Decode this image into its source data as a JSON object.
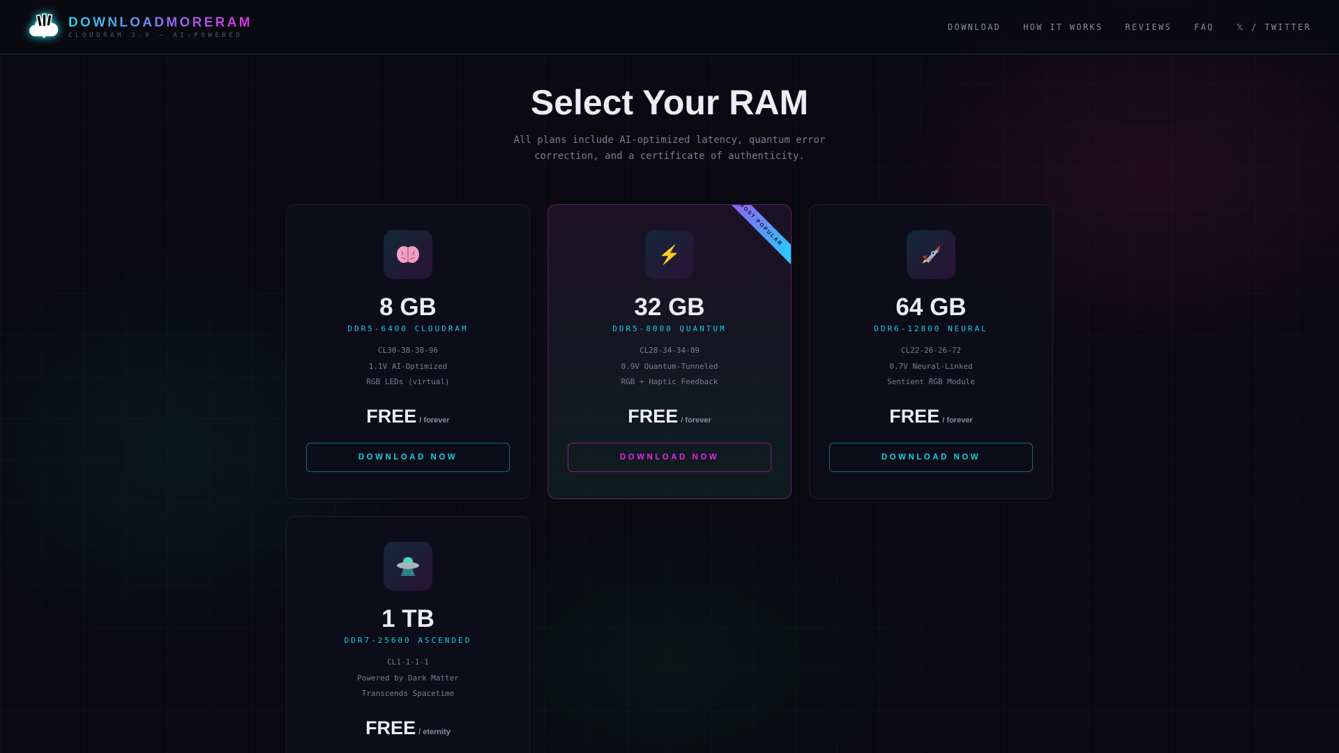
{
  "header": {
    "brand": "DOWNLOADMORERAM",
    "tagline": "CLOUDRAM 3.0 — AI-POWERED",
    "nav": [
      "DOWNLOAD",
      "HOW IT WORKS",
      "REVIEWS",
      "FAQ",
      "𝕏 / TWITTER"
    ]
  },
  "hero": {
    "title": "Select Your RAM",
    "subtitle": "All plans include AI-optimized latency, quantum error correction, and a certificate of authenticity."
  },
  "plans": [
    {
      "icon": "brain-icon",
      "size": "8 GB",
      "model": "DDR5-6400 CLOUDRAM",
      "specs": [
        "CL30-38-38-96",
        "1.1V AI-Optimized",
        "RGB LEDs (virtual)"
      ],
      "price": "FREE",
      "period": "/ forever",
      "button": "DOWNLOAD NOW"
    },
    {
      "icon": "lightning-icon",
      "glyph": "⚡",
      "size": "32 GB",
      "model": "DDR5-8000 QUANTUM",
      "specs": [
        "CL28-34-34-89",
        "0.9V Quantum-Tunneled",
        "RGB + Haptic Feedback"
      ],
      "price": "FREE",
      "period": "/ forever",
      "button": "DOWNLOAD NOW",
      "badge": "MOST POPULAR"
    },
    {
      "icon": "rocket-icon",
      "size": "64 GB",
      "model": "DDR6-12800 NEURAL",
      "specs": [
        "CL22-26-26-72",
        "0.7V Neural-Linked",
        "Sentient RGB Module"
      ],
      "price": "FREE",
      "period": "/ forever",
      "button": "DOWNLOAD NOW"
    },
    {
      "icon": "ufo-icon",
      "size": "1 TB",
      "model": "DDR7-25600 ASCENDED",
      "specs": [
        "CL1-1-1-1",
        "Powered by Dark Matter",
        "Transcends Spacetime"
      ],
      "price": "FREE",
      "period": "/ eternity"
    }
  ]
}
